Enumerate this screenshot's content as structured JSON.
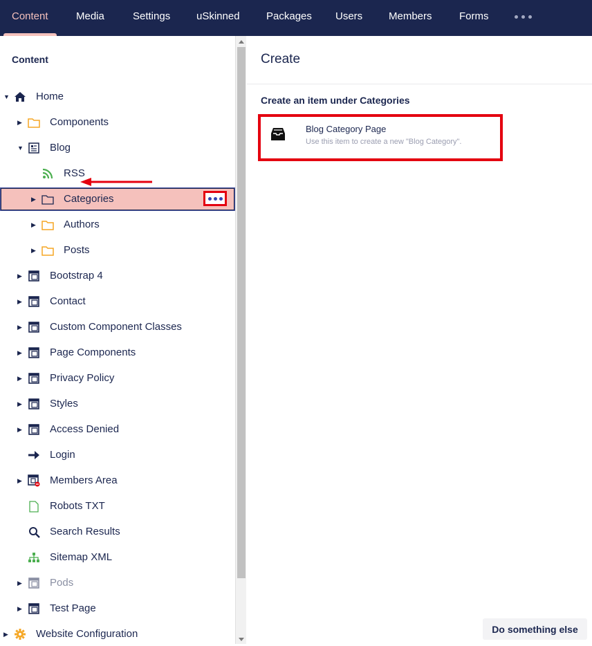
{
  "nav": {
    "items": [
      "Content",
      "Media",
      "Settings",
      "uSkinned",
      "Packages",
      "Users",
      "Members",
      "Forms"
    ],
    "active": "Content"
  },
  "sidebar": {
    "title": "Content",
    "tree": [
      {
        "label": "Home",
        "icon": "home-icon",
        "expanded": true
      },
      {
        "label": "Components",
        "icon": "folder-icon"
      },
      {
        "label": "Blog",
        "icon": "blog-icon",
        "expanded": true
      },
      {
        "label": "RSS",
        "icon": "rss-icon"
      },
      {
        "label": "Categories",
        "icon": "folder-outline-icon",
        "selected": true
      },
      {
        "label": "Authors",
        "icon": "folder-icon"
      },
      {
        "label": "Posts",
        "icon": "folder-icon"
      },
      {
        "label": "Bootstrap 4",
        "icon": "page-layout-icon"
      },
      {
        "label": "Contact",
        "icon": "page-layout-icon"
      },
      {
        "label": "Custom Component Classes",
        "icon": "page-layout-icon"
      },
      {
        "label": "Page Components",
        "icon": "page-layout-icon"
      },
      {
        "label": "Privacy Policy",
        "icon": "page-layout-icon"
      },
      {
        "label": "Styles",
        "icon": "page-layout-icon"
      },
      {
        "label": "Access Denied",
        "icon": "page-layout-icon"
      },
      {
        "label": "Login",
        "icon": "arrow-right-icon"
      },
      {
        "label": "Members Area",
        "icon": "page-restricted-icon"
      },
      {
        "label": "Robots TXT",
        "icon": "document-icon"
      },
      {
        "label": "Search Results",
        "icon": "search-icon"
      },
      {
        "label": "Sitemap XML",
        "icon": "sitemap-icon"
      },
      {
        "label": "Pods",
        "icon": "page-layout-icon",
        "muted": true
      },
      {
        "label": "Test Page",
        "icon": "page-layout-icon"
      },
      {
        "label": "Website Configuration",
        "icon": "gear-icon"
      }
    ]
  },
  "main": {
    "title": "Create",
    "subtitle": "Create an item under Categories",
    "item": {
      "name": "Blog Category Page",
      "description": "Use this item to create a new \"Blog Category\"."
    },
    "secondary_button": "Do something else"
  },
  "colors": {
    "nav_bg": "#1b264f",
    "accent": "#f5c1bc",
    "highlight": "#e4000f",
    "folder": "#f5a623",
    "rss": "#4caf50"
  }
}
